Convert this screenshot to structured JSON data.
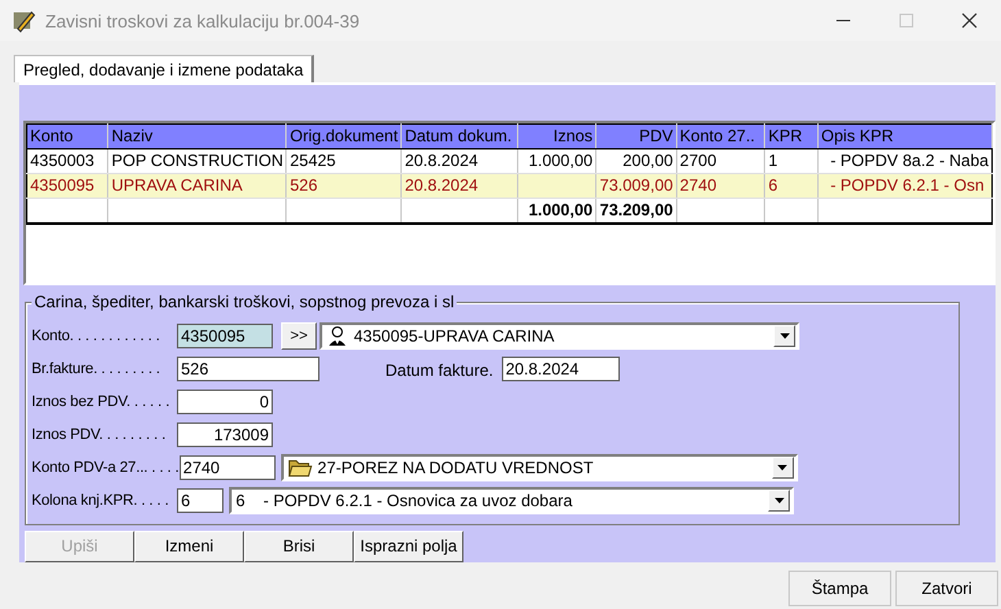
{
  "window": {
    "title": "Zavisni troskovi za kalkulaciju br.004-39"
  },
  "tabs": [
    {
      "label": "Pregled, dodavanje i izmene podataka",
      "selected": true
    }
  ],
  "table": {
    "columns": [
      {
        "label": "Konto",
        "kind": "text"
      },
      {
        "label": "Naziv",
        "kind": "text"
      },
      {
        "label": "Orig.dokument",
        "kind": "text"
      },
      {
        "label": "Datum dokum.",
        "kind": "text"
      },
      {
        "label": "Iznos",
        "kind": "amount"
      },
      {
        "label": "PDV",
        "kind": "amount"
      },
      {
        "label": "Konto 27..",
        "kind": "text"
      },
      {
        "label": "KPR",
        "kind": "text"
      },
      {
        "label": "Opis KPR",
        "kind": "text"
      }
    ],
    "rows": [
      {
        "kind": "data",
        "selected": false,
        "cells": [
          "4350003",
          "POP CONSTRUCTION",
          "25425",
          "20.8.2024",
          "1.000,00",
          "200,00",
          "2700",
          "1",
          "  - POPDV 8a.2 - Naba"
        ]
      },
      {
        "kind": "data",
        "selected": true,
        "cells": [
          "4350095",
          "UPRAVA CARINA",
          "526",
          "20.8.2024",
          "",
          "73.009,00",
          "2740",
          "6",
          "  - POPDV 6.2.1 - Osn"
        ]
      },
      {
        "kind": "total",
        "selected": false,
        "cells": [
          "",
          "",
          "",
          "",
          "1.000,00",
          "73.209,00",
          "",
          "",
          ""
        ]
      }
    ]
  },
  "form": {
    "title": "Carina, špediter, bankarski troškovi, sopstnog prevoza i sl",
    "rows": [
      {
        "kind": "lookup",
        "label": "Konto. . . . . . . . . . . .",
        "value": "4350095",
        "button": ">>",
        "combo": "4350095-UPRAVA CARINA"
      },
      {
        "kind": "text-date",
        "label": "Br.fakture. . . . . . . . .",
        "value": "526",
        "date_label": "Datum fakture.",
        "date": "20.8.2024"
      },
      {
        "kind": "number",
        "label": "Iznos bez PDV. . . . . .",
        "value": "0"
      },
      {
        "kind": "number",
        "label": "Iznos PDV. . . . . . . . .",
        "value": "173009"
      },
      {
        "kind": "account",
        "label": "Konto PDV-a 27... . . . .",
        "value": "2740",
        "combo": "27-POREZ NA DODATU VREDNOST"
      },
      {
        "kind": "column",
        "label": "Kolona knj.KPR. . . . .",
        "value": "6",
        "combo": "6    - POPDV 6.2.1 - Osnovica za uvoz dobara"
      }
    ]
  },
  "buttons": [
    {
      "label": "Upiši",
      "disabled": true
    },
    {
      "label": "Izmeni",
      "disabled": false
    },
    {
      "label": "Brisi",
      "disabled": false
    },
    {
      "label": "Isprazni polja",
      "disabled": false
    }
  ],
  "footer_buttons": [
    {
      "label": "Štampa"
    },
    {
      "label": "Zatvori"
    }
  ]
}
